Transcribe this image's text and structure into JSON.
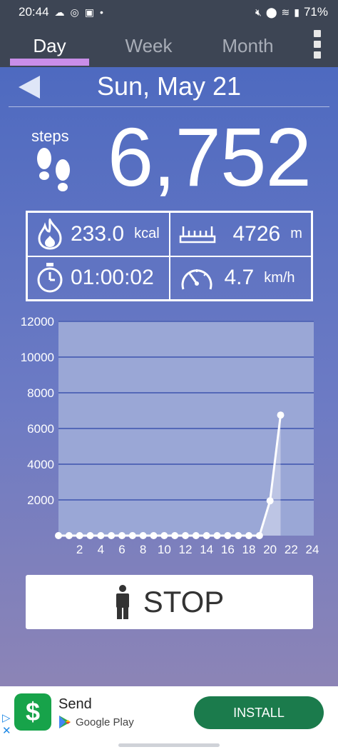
{
  "status_bar": {
    "time": "20:44",
    "left_icons": [
      "cloud-icon",
      "camera-icon",
      "calendar-icon",
      "dot-icon"
    ],
    "right_icons": [
      "mute-icon",
      "location-icon",
      "wifi-icon",
      "signal-icon"
    ],
    "battery": "71%"
  },
  "tabs": [
    {
      "label": "Day",
      "active": true
    },
    {
      "label": "Week",
      "active": false
    },
    {
      "label": "Month",
      "active": false
    }
  ],
  "header": {
    "date": "Sun, May 21"
  },
  "steps": {
    "label": "steps",
    "value": "6,752"
  },
  "stats": {
    "calories": {
      "value": "233.0",
      "unit": "kcal"
    },
    "distance": {
      "value": "4726",
      "unit": "m"
    },
    "duration": {
      "value": "01:00:02"
    },
    "speed": {
      "value": "4.7",
      "unit": "km/h"
    }
  },
  "chart_data": {
    "type": "area",
    "x": [
      0,
      1,
      2,
      3,
      4,
      5,
      6,
      7,
      8,
      9,
      10,
      11,
      12,
      13,
      14,
      15,
      16,
      17,
      18,
      19,
      20,
      21
    ],
    "values": [
      0,
      0,
      0,
      0,
      0,
      0,
      0,
      0,
      0,
      0,
      0,
      0,
      0,
      0,
      0,
      0,
      0,
      0,
      0,
      0,
      1950,
      6752
    ],
    "x_ticks": [
      2,
      4,
      6,
      8,
      10,
      12,
      14,
      16,
      18,
      20,
      22,
      24
    ],
    "x_tick_labels": [
      "2",
      "4",
      "6",
      "8",
      "10",
      "12",
      "14",
      "16",
      "18",
      "20",
      "22",
      "24"
    ],
    "y_ticks": [
      2000,
      4000,
      6000,
      8000,
      10000,
      12000
    ],
    "y_tick_labels": [
      "2000",
      "4000",
      "6000",
      "8000",
      "10000",
      "12000"
    ],
    "xlim": [
      0,
      24
    ],
    "ylim": [
      0,
      12000
    ],
    "grid": true,
    "colors": {
      "line": "#ffffff",
      "grid": "#5468b8",
      "plot_bg": "#9aa7d6"
    }
  },
  "stop_button": {
    "label": "STOP"
  },
  "ad": {
    "app_name": "Send",
    "store": "Google Play",
    "install_label": "INSTALL",
    "logo_symbol": "$"
  }
}
